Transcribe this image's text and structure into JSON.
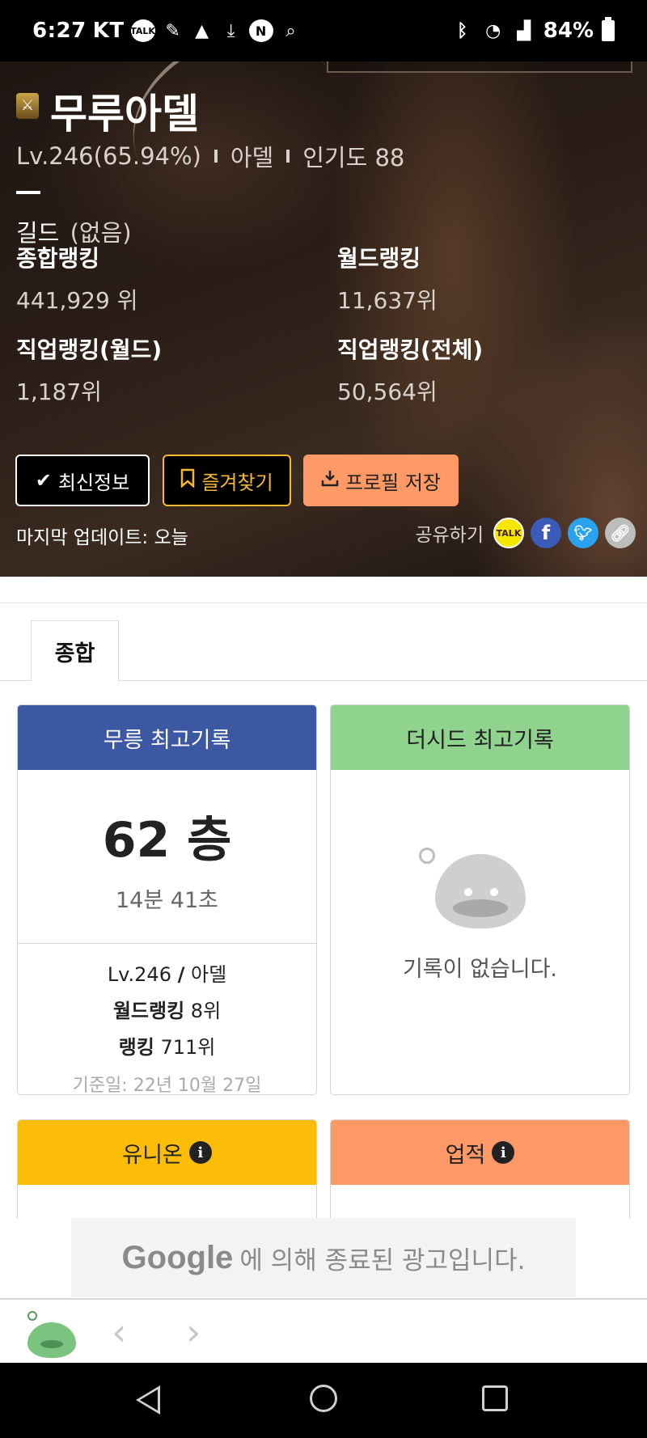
{
  "status_bar": {
    "time": "6:27",
    "carrier": "KT",
    "battery": "84%"
  },
  "profile": {
    "name": "무루아델",
    "level": "Lv.246(65.94%)",
    "world": "아델",
    "popularity": "인기도 88",
    "guild_label": "길드",
    "guild_value": "(없음)",
    "rankings": {
      "overall_label": "종합랭킹",
      "overall_value": "441,929 위",
      "world_label": "월드랭킹",
      "world_value": "11,637위",
      "job_world_label": "직업랭킹(월드)",
      "job_world_value": "1,187위",
      "job_all_label": "직업랭킹(전체)",
      "job_all_value": "50,564위"
    },
    "buttons": {
      "latest": "최신정보",
      "favorite": "즐겨찾기",
      "save_profile": "프로필 저장"
    },
    "last_update": "마지막 업데이트: 오늘",
    "share_label": "공유하기"
  },
  "tabs": {
    "overall": "종합"
  },
  "mureung": {
    "title": "무릉 최고기록",
    "floor": "62 층",
    "time": "14분 41초",
    "level": "Lv.246",
    "slash": "/",
    "world": "아델",
    "world_rank_label": "월드랭킹",
    "world_rank_value": "8위",
    "rank_label": "랭킹",
    "rank_value": "711위",
    "base_date": "기준일: 22년 10월 27일"
  },
  "theseed": {
    "title": "더시드 최고기록",
    "empty": "기록이 없습니다."
  },
  "union": {
    "title": "유니온"
  },
  "achievement": {
    "title": "업적"
  },
  "ad": {
    "brand": "Google",
    "text": "에 의해 종료된 광고입니다."
  },
  "colors": {
    "mureung_header": "#3d58a3",
    "theseed_header": "#8fd38f",
    "union_header": "#fbbd08",
    "achievement_header": "#fd9966",
    "favorite_accent": "#f5b82e",
    "save_button": "#ff9a66"
  }
}
